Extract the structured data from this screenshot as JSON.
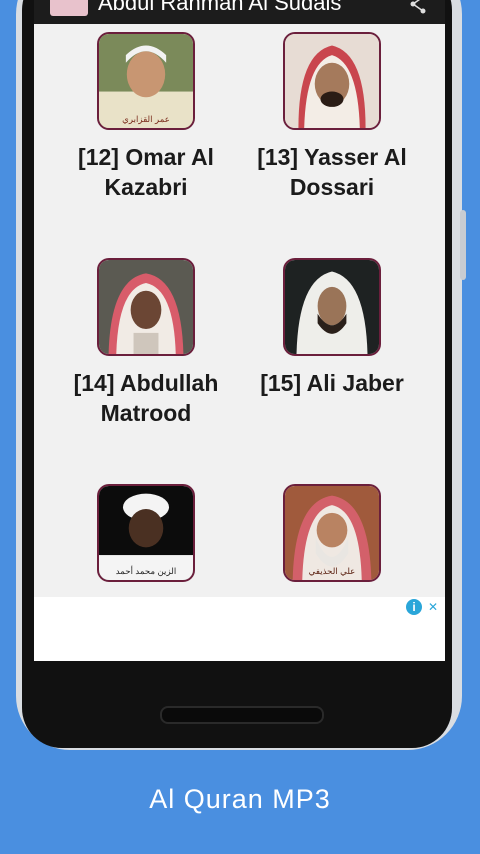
{
  "app_bar": {
    "title": "Abdul Rahman Al Sudais",
    "app_icon": "app-logo-icon",
    "share_icon": "share-icon"
  },
  "reciters": [
    {
      "label": "[12] Omar Al Kazabri",
      "photo_caption": "عمر القزابري"
    },
    {
      "label": "[13] Yasser Al Dossari",
      "photo_caption": ""
    },
    {
      "label": "[14] Abdullah Matrood",
      "photo_caption": ""
    },
    {
      "label": "[15] Ali Jaber",
      "photo_caption": ""
    },
    {
      "label": "",
      "photo_caption": "الزين محمد أحمد"
    },
    {
      "label": "",
      "photo_caption": "علي الحذيفي"
    }
  ],
  "ad": {
    "info_icon": "i",
    "close_icon": "✕"
  },
  "caption": "Al Quran MP3",
  "colors": {
    "background": "#4a8fe0",
    "thumb_border": "#6b1f3c",
    "ad_icon": "#2aa6d9"
  }
}
